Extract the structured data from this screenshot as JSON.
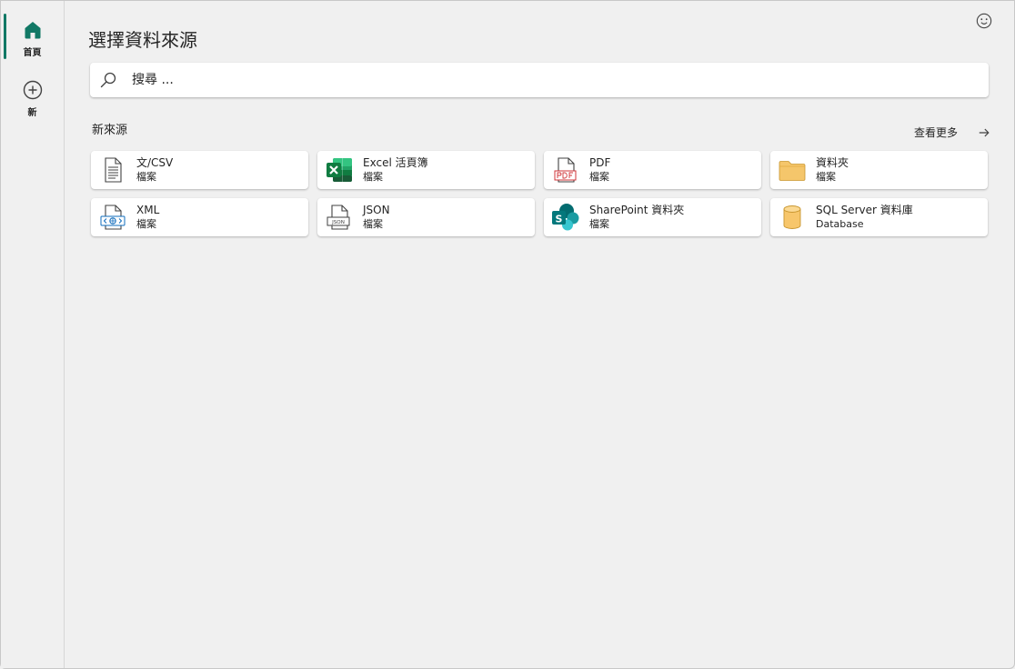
{
  "rail": {
    "home_label": "首頁",
    "new_label": "新"
  },
  "header": {
    "title": "選擇資料來源",
    "feedback_icon": "smiley-icon"
  },
  "search": {
    "placeholder": "搜尋 ..."
  },
  "section": {
    "title": "新來源",
    "see_more": "查看更多"
  },
  "sources": [
    {
      "name": "文/CSV",
      "sub": "檔案",
      "icon": "text-file-icon"
    },
    {
      "name": "Excel 活頁簿",
      "sub": "檔案",
      "icon": "excel-icon"
    },
    {
      "name": "PDF",
      "sub": "檔案",
      "icon": "pdf-icon"
    },
    {
      "name": "資料夾",
      "sub": "檔案",
      "icon": "folder-icon"
    },
    {
      "name": "XML",
      "sub": "檔案",
      "icon": "xml-icon"
    },
    {
      "name": "JSON",
      "sub": "檔案",
      "icon": "json-icon"
    },
    {
      "name": "SharePoint 資料夾",
      "sub": "檔案",
      "icon": "sharepoint-icon"
    },
    {
      "name": "SQL Server 資料庫",
      "sub": "Database",
      "icon": "database-icon"
    }
  ],
  "colors": {
    "accent": "#117865",
    "excel": "#107c41",
    "sharepoint": "#03787c",
    "pdf": "#d13438",
    "folder": "#f5c66b",
    "database": "#f7c66b"
  }
}
